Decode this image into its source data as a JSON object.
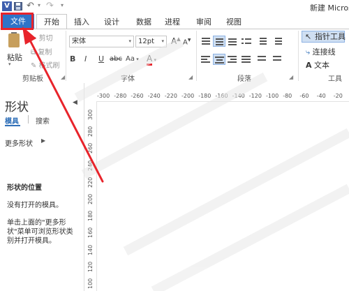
{
  "titlebar": {
    "app_icon": "V",
    "window_title": "新建 Micros",
    "icons": [
      "visio-app-icon",
      "save-icon",
      "undo-icon",
      "redo-icon",
      "customize-qat-icon"
    ]
  },
  "tabs": [
    {
      "label": "文件"
    },
    {
      "label": "开始"
    },
    {
      "label": "插入"
    },
    {
      "label": "设计"
    },
    {
      "label": "数据"
    },
    {
      "label": "进程"
    },
    {
      "label": "审阅"
    },
    {
      "label": "视图"
    }
  ],
  "ribbon": {
    "clipboard": {
      "paste": "粘贴",
      "cut": "剪切",
      "copy": "复制",
      "format_painter": "格式刷",
      "label": "剪贴板"
    },
    "font": {
      "font_name": "宋体",
      "font_size": "12pt",
      "grow": "A",
      "shrink": "A",
      "bold": "B",
      "italic": "I",
      "underline": "U",
      "strike": "abc",
      "case": "Aa",
      "font_color": "A",
      "label": "字体"
    },
    "paragraph": {
      "label": "段落"
    },
    "tools": {
      "pointer": "指针工具",
      "connector": "连接线",
      "text": "文本",
      "label": "工具"
    }
  },
  "shapes_panel": {
    "title": "形状",
    "tab_stencils": "模具",
    "tab_search": "搜索",
    "more_shapes": "更多形状",
    "location_heading": "形状的位置",
    "no_stencil": "没有打开的模具。",
    "hint_lines": [
      "单击上面的\"更多形",
      "状\"菜单可浏览形状类",
      "别并打开模具。"
    ]
  },
  "ruler": {
    "h_ticks": [
      "-300",
      "-280",
      "-260",
      "-240",
      "-220",
      "-200",
      "-180",
      "-160",
      "-140",
      "-120",
      "-100",
      "-80",
      "-60",
      "-40",
      "-20"
    ],
    "v_ticks": [
      "300",
      "280",
      "260",
      "240",
      "220",
      "200",
      "180",
      "160",
      "140",
      "120",
      "100"
    ]
  },
  "colors": {
    "file_tab": "#2f74c8",
    "highlight_red": "#e8242b",
    "active_blue": "#cfdff2",
    "stencil_blue": "#2f6fb8"
  }
}
